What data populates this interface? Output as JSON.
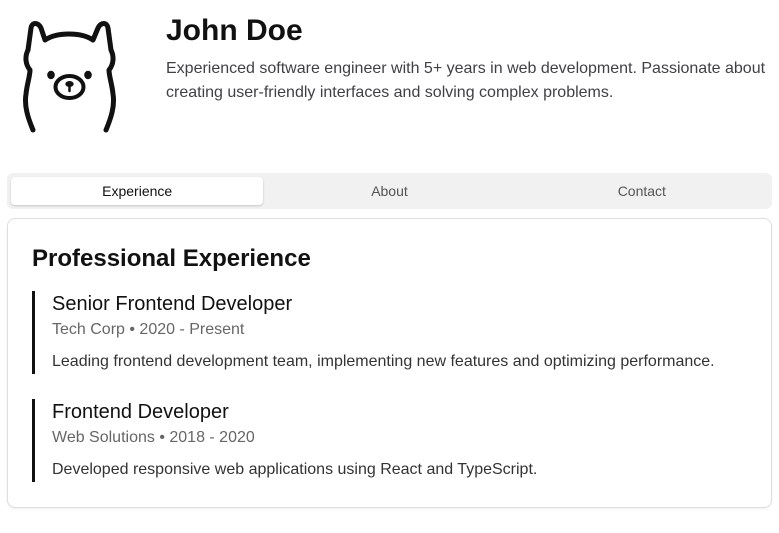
{
  "profile": {
    "avatar_icon": "llama-icon",
    "name": "John Doe",
    "bio": "Experienced software engineer with 5+ years in web development. Passionate about creating user-friendly interfaces and solving complex problems."
  },
  "tabs": [
    {
      "label": "Experience",
      "active": true
    },
    {
      "label": "About",
      "active": false
    },
    {
      "label": "Contact",
      "active": false
    }
  ],
  "experience": {
    "heading": "Professional Experience",
    "jobs": [
      {
        "title": "Senior Frontend Developer",
        "meta": "Tech Corp • 2020 - Present",
        "description": "Leading frontend development team, implementing new features and optimizing performance."
      },
      {
        "title": "Frontend Developer",
        "meta": "Web Solutions • 2018 - 2020",
        "description": "Developed responsive web applications using React and TypeScript."
      }
    ]
  }
}
